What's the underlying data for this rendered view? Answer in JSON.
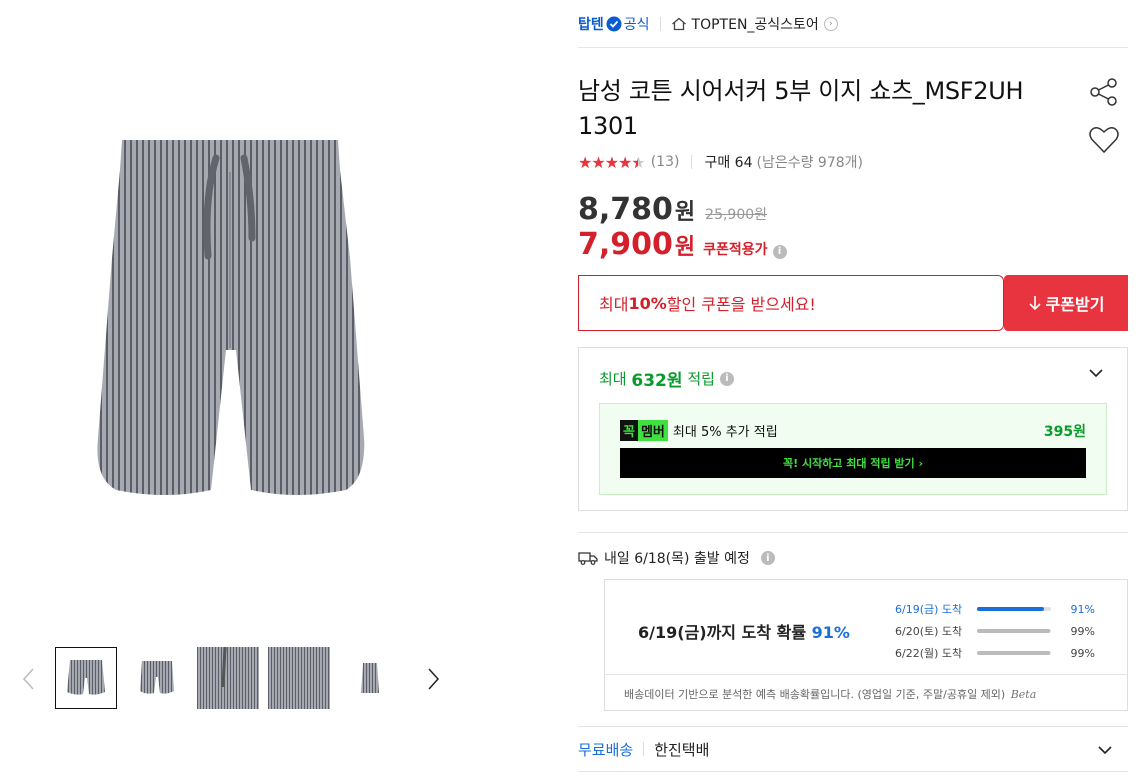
{
  "store": {
    "brand": "탑텐",
    "official": "공식",
    "store_name": "TOPTEN_공식스토어"
  },
  "product": {
    "title": "남성 코튼 시어서커 5부 이지 쇼츠_MSF2UH 1301",
    "rating_stars": 4.5,
    "review_count": "(13)",
    "purchase": "구매 64",
    "remaining": "(남은수량 978개)"
  },
  "price": {
    "sale": "8,780",
    "sale_unit": "원",
    "original": "25,900원",
    "coupon_price": "7,900",
    "coupon_unit": "원",
    "coupon_applied": "쿠폰적용가"
  },
  "coupon": {
    "text_prefix": "최대 ",
    "text_bold": "10%",
    "text_suffix": " 할인 쿠폰을 받으세요!",
    "button": "쿠폰받기"
  },
  "points": {
    "head_prefix": "최대 ",
    "head_amount": "632원",
    "head_suffix": " 적립",
    "badge_a": "꼭",
    "badge_b": "멤버",
    "member_text": "최대 5% 추가 적립",
    "member_amount": "395원",
    "member_button": "꼭! 시작하고 최대 적립 받기 ›"
  },
  "delivery": {
    "headline": "내일 6/18(목) 출발 예정",
    "summary_prefix": "6/19(금)까지 도착 확률 ",
    "summary_pct": "91%",
    "rows": [
      {
        "date": "6/19(금) 도착",
        "value": 0.91,
        "label": "91%"
      },
      {
        "date": "6/20(토) 도착",
        "value": 0.99,
        "label": "99%"
      },
      {
        "date": "6/22(월) 도착",
        "value": 0.99,
        "label": "99%"
      }
    ],
    "note": "배송데이터 기반으로 분석한 예측 배송확률입니다. (영업일 기준, 주말/공휴일 제외)",
    "beta": "Beta"
  },
  "shipping": {
    "free": "무료배송",
    "carrier": "한진택배"
  },
  "colors": {
    "accent_red": "#e8343f",
    "link_blue": "#1a6fd8",
    "point_green": "#0b9b2c"
  }
}
